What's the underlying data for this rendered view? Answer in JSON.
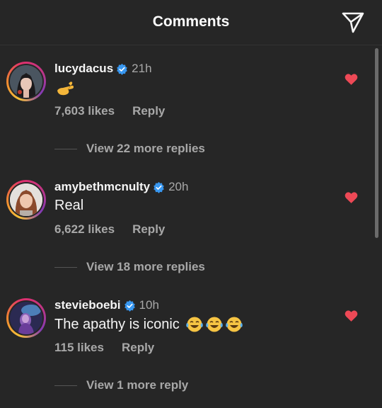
{
  "header": {
    "title": "Comments",
    "share_icon": "paper-plane-icon"
  },
  "colors": {
    "background": "#262626",
    "verified": "#3897f0",
    "heart": "#ed4956",
    "secondary_text": "#a8a8a8"
  },
  "comments": [
    {
      "username": "lucydacus",
      "verified": true,
      "time": "21h",
      "text": "",
      "text_emojis": [
        "pinching-hand-emoji"
      ],
      "likes": "7,603 likes",
      "reply_label": "Reply",
      "view_replies": "View 22 more replies",
      "liked": true
    },
    {
      "username": "amybethmcnulty",
      "verified": true,
      "time": "20h",
      "text": "Real",
      "text_emojis": [],
      "likes": "6,622 likes",
      "reply_label": "Reply",
      "view_replies": "View 18 more replies",
      "liked": true
    },
    {
      "username": "stevieboebi",
      "verified": true,
      "time": "10h",
      "text": "The apathy is iconic",
      "text_emojis": [
        "tears-of-joy-emoji",
        "tears-of-joy-emoji",
        "tears-of-joy-emoji"
      ],
      "likes": "115 likes",
      "reply_label": "Reply",
      "view_replies": "View 1 more reply",
      "liked": true
    }
  ]
}
